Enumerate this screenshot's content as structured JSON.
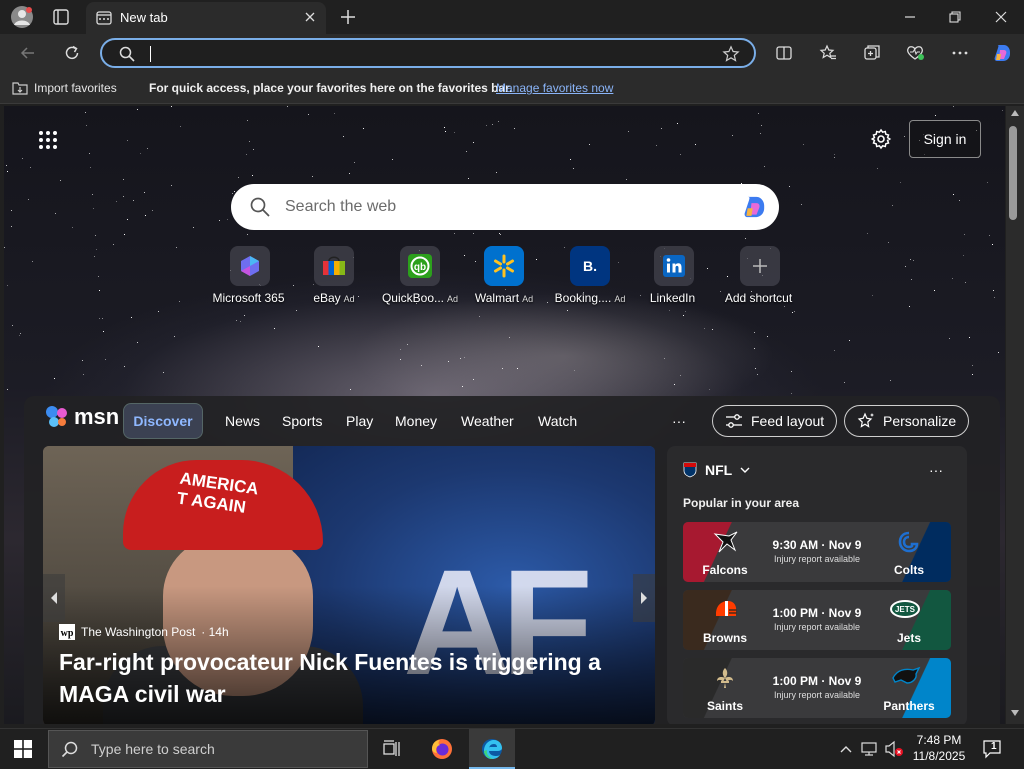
{
  "browser": {
    "tab_title": "New tab",
    "address_value": "",
    "favorites_bar": {
      "import_label": "Import favorites",
      "message": "For quick access, place your favorites here on the favorites bar.",
      "manage_link": "Manage favorites now"
    }
  },
  "newtab": {
    "signin_label": "Sign in",
    "search_placeholder": "Search the web",
    "shortcuts": [
      {
        "label": "Microsoft 365",
        "ad": ""
      },
      {
        "label": "eBay",
        "ad": "Ad"
      },
      {
        "label": "QuickBoo...",
        "ad": "Ad"
      },
      {
        "label": "Walmart",
        "ad": "Ad"
      },
      {
        "label": "Booking....",
        "ad": "Ad"
      },
      {
        "label": "LinkedIn",
        "ad": ""
      },
      {
        "label": "Add shortcut",
        "ad": ""
      }
    ]
  },
  "msn": {
    "logo_text": "msn",
    "tabs": [
      "Discover",
      "News",
      "Sports",
      "Play",
      "Money",
      "Weather",
      "Watch"
    ],
    "more": "···",
    "feed_layout": "Feed layout",
    "personalize": "Personalize",
    "hero": {
      "hat_text": "AMERICA\nT AGAIN",
      "af_text": "AF",
      "source": "The Washington Post",
      "age": "· 14h",
      "headline": "Far-right provocateur Nick Fuentes is triggering a MAGA civil war"
    },
    "nfl": {
      "title": "NFL",
      "subtitle": "Popular in your area",
      "more": "···",
      "games": [
        {
          "home": "Falcons",
          "away": "Colts",
          "time": "9:30 AM · Nov 9",
          "note": "Injury report available",
          "home_color": "#a71930",
          "away_color": "#002c5f"
        },
        {
          "home": "Browns",
          "away": "Jets",
          "time": "1:00 PM · Nov 9",
          "note": "Injury report available",
          "home_color": "#3a2a1e",
          "away_color": "#125740"
        },
        {
          "home": "Saints",
          "away": "Panthers",
          "time": "1:00 PM · Nov 9",
          "note": "Injury report available",
          "home_color": "#2a2a2a",
          "away_color": "#0085ca"
        }
      ]
    }
  },
  "taskbar": {
    "search_placeholder": "Type here to search",
    "time": "7:48 PM",
    "date": "11/8/2025",
    "notif_count": "1"
  },
  "colors": {
    "accent": "#7aaee8",
    "link": "#8ab4f8",
    "discover_text": "#8fb8ff"
  }
}
